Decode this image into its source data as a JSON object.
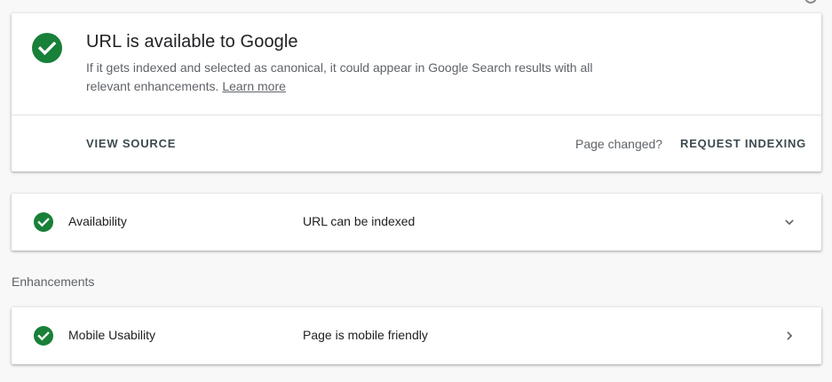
{
  "colors": {
    "success_green": "#188038",
    "text_primary": "#202124",
    "text_secondary": "#5f6368",
    "background": "#f8f8f8"
  },
  "status": {
    "icon": "check-circle-icon",
    "title": "URL is available to Google",
    "description": "If it gets indexed and selected as canonical, it could appear in Google Search results with all relevant enhancements.",
    "learn_more": "Learn more",
    "view_source_label": "VIEW SOURCE",
    "page_changed_text": "Page changed?",
    "request_indexing_label": "REQUEST INDEXING"
  },
  "availability": {
    "icon": "check-circle-icon",
    "label": "Availability",
    "value": "URL can be indexed",
    "chevron": "chevron-down-icon"
  },
  "enhancements": {
    "section_label": "Enhancements",
    "items": [
      {
        "icon": "check-circle-icon",
        "label": "Mobile Usability",
        "value": "Page is mobile friendly",
        "chevron": "chevron-right-icon"
      }
    ]
  }
}
